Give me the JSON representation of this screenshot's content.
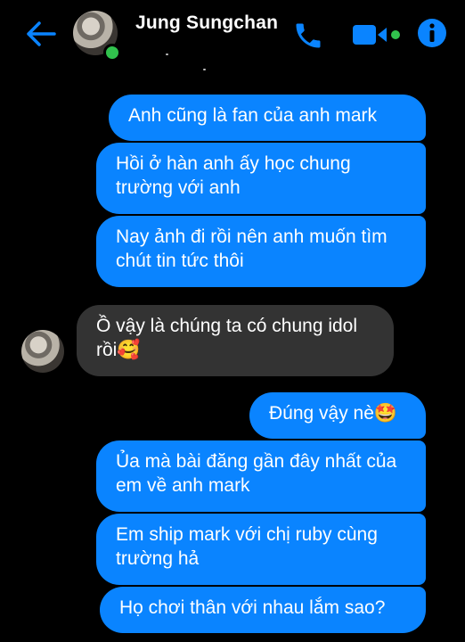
{
  "header": {
    "contact_name": "Jung Sungchan",
    "accent_color": "#0a84ff",
    "presence_color": "#31c24d",
    "icons": [
      "back-arrow-icon",
      "phone-icon",
      "video-camera-icon",
      "info-icon"
    ]
  },
  "messages": [
    {
      "direction": "out",
      "text": "Anh cũng là fan của anh mark"
    },
    {
      "direction": "out",
      "text": "Hồi ở hàn anh ấy học chung trường với anh"
    },
    {
      "direction": "out",
      "text": "Nay ảnh đi rồi nên anh muốn tìm chút tin tức thôi"
    },
    {
      "direction": "in",
      "text": "Ồ vậy là chúng ta có chung idol rồi🥰"
    },
    {
      "direction": "out",
      "text": "Đúng vậy nè🤩"
    },
    {
      "direction": "out",
      "text": "Ủa mà bài đăng gần đây nhất của em về anh mark"
    },
    {
      "direction": "out",
      "text": "Em ship mark với chị ruby cùng trường hả"
    },
    {
      "direction": "out",
      "text": "Họ chơi thân với nhau lắm sao?"
    }
  ]
}
